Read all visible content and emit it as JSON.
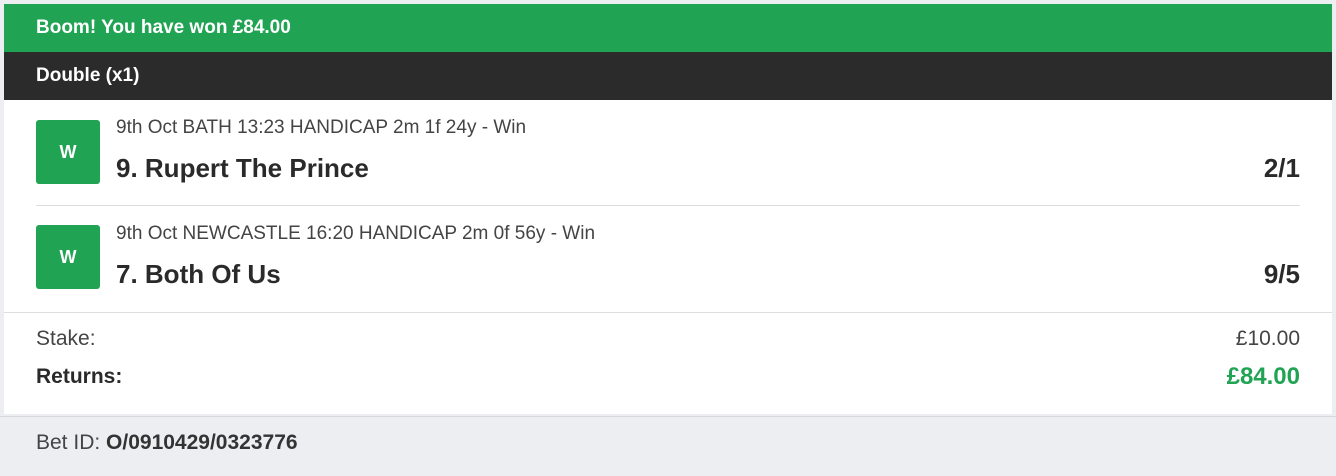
{
  "banner": {
    "message": "Boom! You have won £84.00"
  },
  "bet": {
    "type_label": "Double (x1)",
    "selections": [
      {
        "result_badge": "W",
        "event": "9th Oct BATH 13:23 HANDICAP 2m 1f 24y - Win",
        "runner": "9. Rupert The Prince",
        "odds": "2/1"
      },
      {
        "result_badge": "W",
        "event": "9th Oct NEWCASTLE 16:20 HANDICAP 2m 0f 56y - Win",
        "runner": "7. Both Of Us",
        "odds": "9/5"
      }
    ],
    "stake_label": "Stake:",
    "stake_value": "£10.00",
    "returns_label": "Returns:",
    "returns_value": "£84.00"
  },
  "footer": {
    "bet_id_label": "Bet ID:",
    "bet_id_value": "O/0910429/0323776"
  },
  "colors": {
    "win_green": "#21a354",
    "header_dark": "#2b2b2b",
    "footer_bg": "#eceef1"
  }
}
